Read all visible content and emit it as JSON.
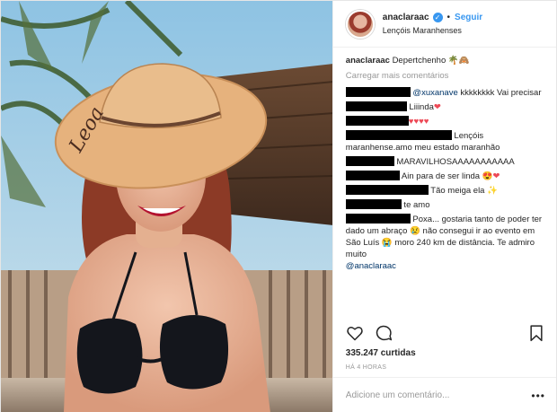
{
  "post": {
    "author": "anaclaraac",
    "follow_label": "Seguir",
    "location": "Lençóis Maranhenses",
    "caption": "Depertchenho 🌴🙈",
    "load_more": "Carregar mais comentários",
    "comments": [
      {
        "redacted_width": 72,
        "mention": "@xuxanave",
        "text": " kkkkkkkk Vai precisar"
      },
      {
        "redacted_width": 68,
        "mention": "",
        "text": " Liiinda",
        "suffix": "❤"
      },
      {
        "redacted_width": 70,
        "mention": "",
        "text": "",
        "suffix": "♥♥♥♥"
      },
      {
        "redacted_width": 118,
        "mention": "",
        "text": " Lençóis maranhense.amo meu estado maranhão"
      },
      {
        "redacted_width": 54,
        "mention": "",
        "text": " MARAVILHOSAAAAAAAAAAA"
      },
      {
        "redacted_width": 60,
        "mention": "",
        "text": " Ain para de ser linda 😍",
        "suffix": "❤"
      },
      {
        "redacted_width": 92,
        "mention": "",
        "text": " Tão meiga ela ✨"
      },
      {
        "redacted_width": 62,
        "mention": "",
        "text": " te amo"
      },
      {
        "redacted_width": 72,
        "mention": "",
        "text": " Poxa... gostaria tanto de poder ter dado um abraço 😢 não consegui ir ao evento em São Luís 😭 moro 240 km de distância. Te admiro muito",
        "tail_mention": "@anaclaraac"
      }
    ],
    "likes": "335.247 curtidas",
    "time_ago": "HÁ 4 HORAS",
    "comment_placeholder": "Adicione um comentário...",
    "more_label": "•••",
    "hat_text": "Leoa"
  },
  "colors": {
    "link": "#3897f0",
    "mention": "#003569",
    "heart": "#ed4956",
    "muted": "#999999"
  },
  "icons": [
    "verified-badge-icon",
    "heart-icon",
    "comment-icon",
    "bookmark-icon",
    "more-options-icon"
  ]
}
